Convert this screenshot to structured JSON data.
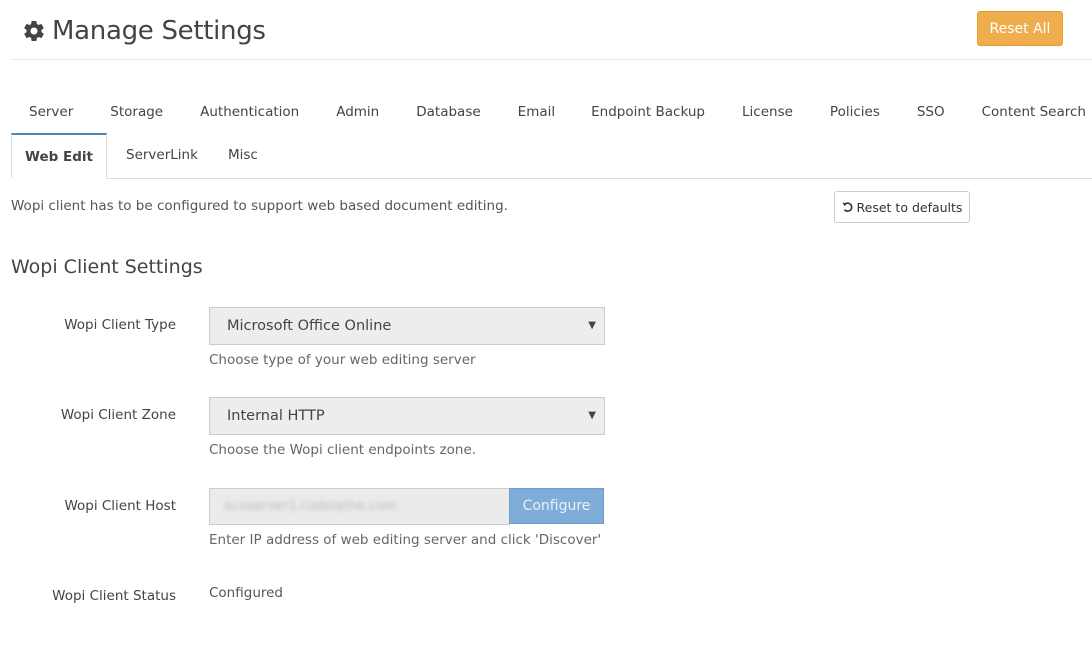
{
  "header": {
    "title": "Manage Settings",
    "title_icon": "gear-icon",
    "reset_all_label": "Reset All"
  },
  "tabs": {
    "row1": [
      "Server",
      "Storage",
      "Authentication",
      "Admin",
      "Database",
      "Email",
      "Endpoint Backup",
      "License",
      "Policies",
      "SSO",
      "Content Search"
    ],
    "active": "Web Edit",
    "row2_other": [
      "ServerLink",
      "Misc"
    ]
  },
  "intro_text": "Wopi client has to be configured to support web based document editing.",
  "reset_defaults_label": "Reset to defaults",
  "reset_defaults_icon": "undo-icon",
  "section_title": "Wopi Client Settings",
  "fields": {
    "client_type": {
      "label": "Wopi Client Type",
      "value": "Microsoft Office Online",
      "help": "Choose type of your web editing server"
    },
    "client_zone": {
      "label": "Wopi Client Zone",
      "value": "Internal HTTP",
      "help": "Choose the Wopi client endpoints zone."
    },
    "client_host": {
      "label": "Wopi Client Host",
      "value": "ecoserver1.codelathe.com",
      "button": "Configure",
      "help": "Enter IP address of web editing server and click 'Discover'"
    },
    "client_status": {
      "label": "Wopi Client Status",
      "value": "Configured"
    }
  },
  "colors": {
    "reset_all_bg": "#f0ad4e",
    "configure_bg": "#7fadd8",
    "active_tab_border": "#4a8ab5"
  }
}
